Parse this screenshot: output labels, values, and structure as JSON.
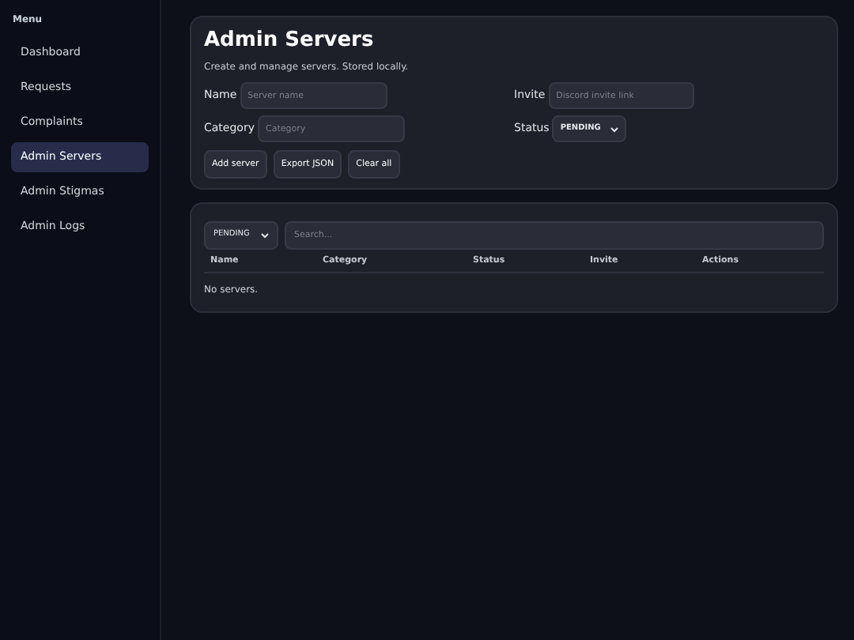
{
  "sidebar": {
    "heading": "Menu",
    "items": [
      {
        "label": "Dashboard",
        "selected": false
      },
      {
        "label": "Requests",
        "selected": false
      },
      {
        "label": "Complaints",
        "selected": false
      },
      {
        "label": "Admin Servers",
        "selected": true
      },
      {
        "label": "Admin Stigmas",
        "selected": false
      },
      {
        "label": "Admin Logs",
        "selected": false
      }
    ]
  },
  "form": {
    "title": "Admin Servers",
    "subtitle": "Create and manage servers. Stored locally.",
    "name": {
      "label": "Name",
      "placeholder": "Server name"
    },
    "invite": {
      "label": "Invite",
      "placeholder": "Discord invite link"
    },
    "category": {
      "label": "Category",
      "placeholder": "Category"
    },
    "status": {
      "label": "Status",
      "value": "PENDING"
    },
    "buttons": [
      "Add server",
      "Export JSON",
      "Clear all"
    ]
  },
  "list": {
    "filter": "PENDING",
    "search_placeholder": "Search...",
    "columns": [
      "Name",
      "Category",
      "Status",
      "Invite",
      "Actions"
    ],
    "empty": "No servers."
  }
}
